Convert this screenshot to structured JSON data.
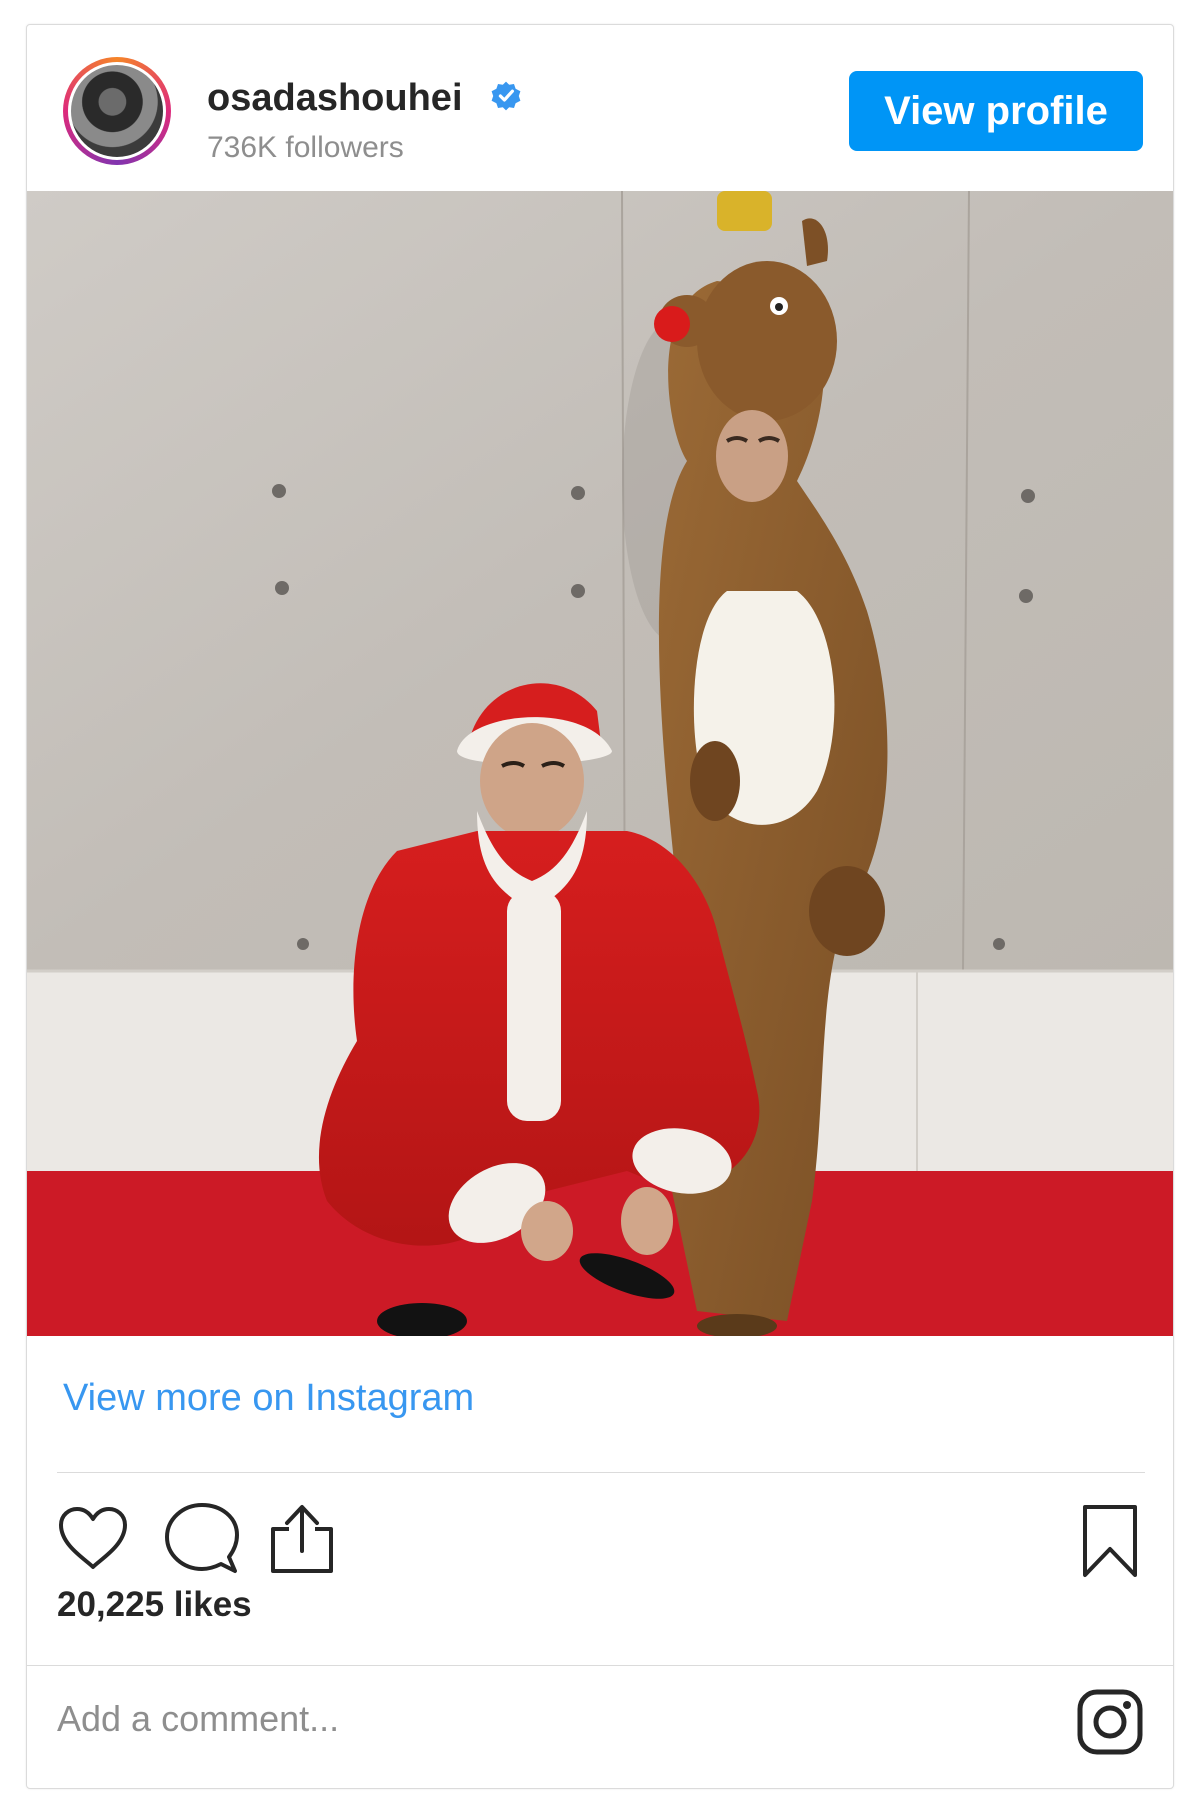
{
  "header": {
    "username": "osadashouhei",
    "followers": "736K followers",
    "view_profile_label": "View profile",
    "verified_icon": "verified-badge-icon"
  },
  "post": {
    "photo_subject": "photo",
    "view_more_label": "View more on Instagram",
    "likes": "20,225 likes"
  },
  "actions": {
    "icons": [
      "heart-icon",
      "comment-icon",
      "share-icon",
      "bookmark-icon"
    ]
  },
  "comment": {
    "placeholder": "Add a comment..."
  },
  "brand": {
    "instagram_icon": "instagram-icon",
    "accent": "#0095f6",
    "link": "#3897f0"
  }
}
